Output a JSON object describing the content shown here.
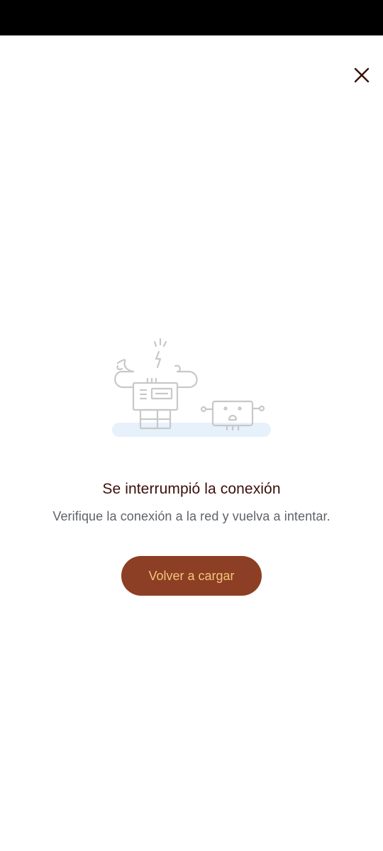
{
  "close_button": {
    "icon": "close-icon"
  },
  "illustration": {
    "icon": "broken-connection-robots-illustration"
  },
  "error": {
    "title": "Se interrumpió la conexión",
    "message": "Verifique la conexión a la red y vuelva a intentar."
  },
  "reload_button": {
    "label": "Volver a cargar"
  },
  "colors": {
    "status_bar": "#000000",
    "background": "#ffffff",
    "title": "#3a0f0a",
    "message": "#5f6368",
    "close_icon": "#3a0f0a",
    "button_background": "#8c3f24",
    "button_text": "#f4c57a",
    "illustration_line": "#c8c8c8",
    "illustration_ground": "#e6f1fb"
  }
}
